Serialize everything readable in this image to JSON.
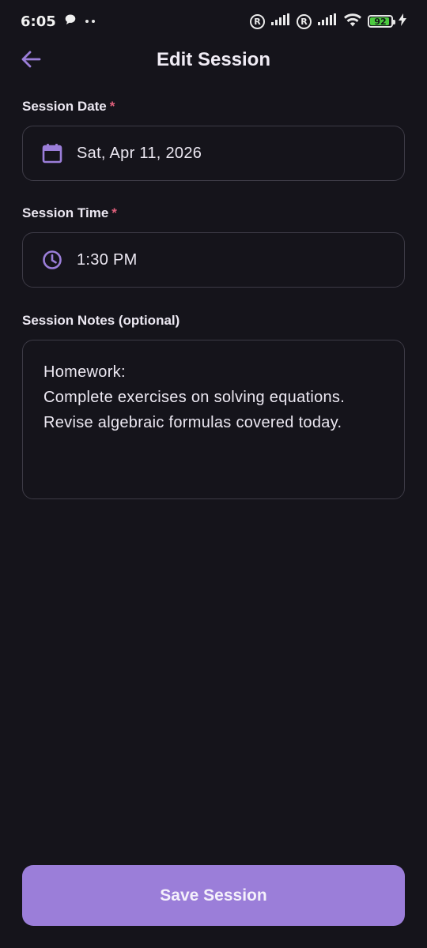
{
  "status_bar": {
    "time": "6:05",
    "battery": "92",
    "battery_level": 0.92,
    "icons": [
      "chat-bubble-icon",
      "dots-icon",
      "registered-icon",
      "signal-icon",
      "registered-icon",
      "signal-icon",
      "wifi-icon",
      "battery-icon",
      "charging-icon"
    ]
  },
  "header": {
    "title": "Edit Session",
    "back_icon": "arrow-left-icon"
  },
  "form": {
    "date_label": "Session Date",
    "date_required": "*",
    "date_value": "Sat, Apr 11, 2026",
    "date_icon": "calendar-icon",
    "time_label": "Session Time",
    "time_required": "*",
    "time_value": "1:30 PM",
    "time_icon": "clock-icon",
    "notes_label": "Session Notes (optional)",
    "notes_lines": [
      "Homework:",
      "Complete exercises on solving equations.",
      "Revise algebraic formulas covered today."
    ]
  },
  "save_button": {
    "label": "Save Session"
  },
  "colors": {
    "background": "#15141b",
    "accent": "#9b7ed9",
    "required": "#e0607c",
    "battery": "#4ccb3f"
  }
}
